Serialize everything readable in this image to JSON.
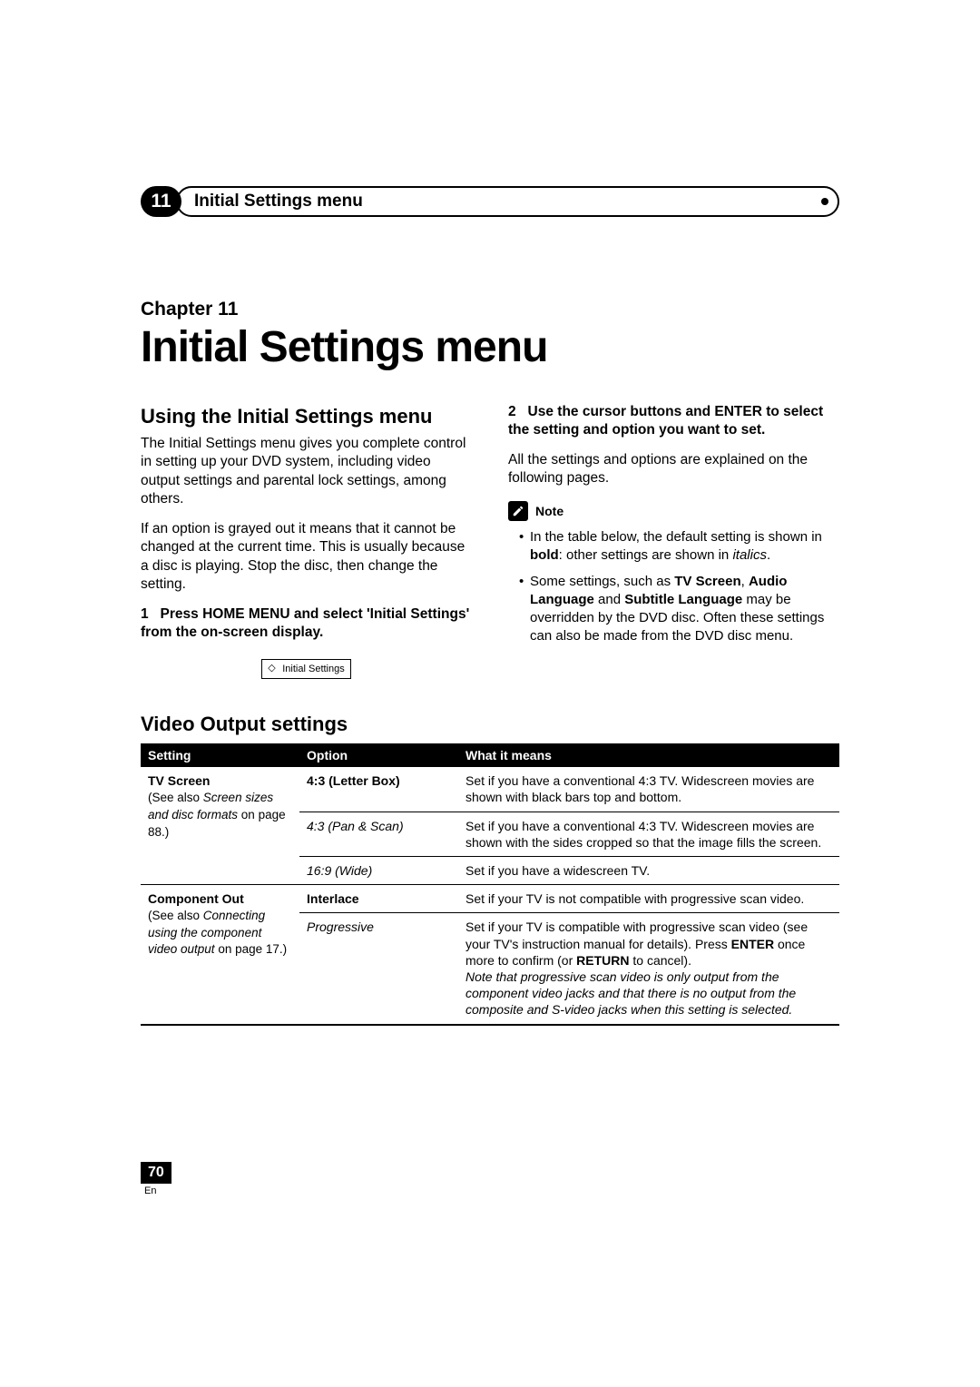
{
  "header": {
    "chapter_number": "11",
    "pill_title": "Initial Settings menu"
  },
  "chapter": {
    "label": "Chapter 11",
    "title": "Initial Settings menu"
  },
  "left": {
    "heading": "Using the Initial Settings menu",
    "p1": "The Initial Settings menu gives you complete control in setting up your DVD system, including video output settings and parental lock settings, among others.",
    "p2": "If an option is grayed out it means that it cannot be changed at the current time. This is usually because a disc is playing. Stop the disc, then change the setting.",
    "step1_num": "1",
    "step1_text": "Press HOME MENU and select 'Initial Settings' from the on-screen display.",
    "callout": "Initial Settings"
  },
  "right": {
    "step2_num": "2",
    "step2_text": "Use the cursor buttons and ENTER to select the setting and option you want to set.",
    "p_after": "All the settings and options are explained on the following pages.",
    "note_label": "Note",
    "note1_a": "In the table below, the default setting is shown in ",
    "note1_bold": "bold",
    "note1_b": ": other settings are shown in ",
    "note1_italics": "italics",
    "note1_c": ".",
    "note2_a": "Some settings, such as ",
    "note2_b1": "TV Screen",
    "note2_sep1": ", ",
    "note2_b2": "Audio Language",
    "note2_sep2": " and ",
    "note2_b3": "Subtitle Language",
    "note2_tail": " may be overridden by the DVD disc. Often these settings can also be made from the DVD disc menu."
  },
  "table": {
    "title": "Video Output settings",
    "headers": {
      "setting": "Setting",
      "option": "Option",
      "means": "What it means"
    },
    "tv_screen": {
      "name": "TV Screen",
      "sub_a": "(See also ",
      "sub_i": "Screen sizes and disc formats",
      "sub_b": " on page 88.)",
      "opt1": "4:3 (Letter Box)",
      "mean1": "Set if you have a conventional 4:3 TV. Widescreen movies are shown with black bars top and bottom.",
      "opt2": "4:3 (Pan & Scan)",
      "mean2": "Set if you have a conventional 4:3 TV. Widescreen movies are shown with the sides cropped so that the image fills the screen.",
      "opt3": "16:9 (Wide)",
      "mean3": "Set if you have a widescreen TV."
    },
    "component": {
      "name": "Component Out",
      "sub_a": "(See also ",
      "sub_i": "Connecting using the component video output",
      "sub_b": " on page 17.)",
      "opt1": "Interlace",
      "mean1": "Set if your TV is not compatible with progressive scan video.",
      "opt2": "Progressive",
      "mean2_a": "Set if your TV is compatible with progressive scan video (see your TV's instruction manual for details). Press ",
      "mean2_b1": "ENTER",
      "mean2_b": " once more to confirm (or ",
      "mean2_b2": "RETURN",
      "mean2_c": " to cancel).",
      "mean2_note": "Note that progressive scan video is only output from the component video jacks and that there is no output from the composite and S-video jacks when this setting is selected."
    }
  },
  "footer": {
    "page": "70",
    "lang": "En"
  }
}
